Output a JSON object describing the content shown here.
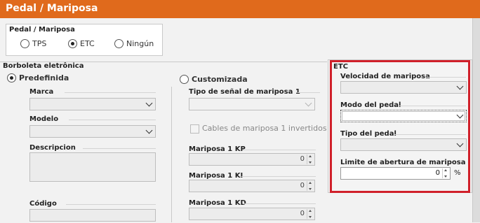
{
  "window": {
    "title": "Pedal / Mariposa"
  },
  "mode_group": {
    "label": "Pedal / Mariposa",
    "options": [
      "TPS",
      "ETC",
      "Ningún"
    ],
    "selected": "ETC"
  },
  "borboleta": {
    "label": "Borboleta eletrônica",
    "predefinida": {
      "label": "Predefinida",
      "marca_label": "Marca",
      "modelo_label": "Modelo",
      "descripcion_label": "Descripcion",
      "codigo_label": "Código"
    },
    "customizada": {
      "label": "Customizada",
      "tipo_label": "Tipo de señal de mariposa 1",
      "cables_label": "Cables de mariposa 1 invertidos",
      "kp_label": "Mariposa 1 KP",
      "kp_value": "0",
      "ki_label": "Mariposa 1 KI",
      "ki_value": "0",
      "kd_label": "Mariposa 1 KD",
      "kd_value": "0"
    }
  },
  "etc": {
    "label": "ETC",
    "velocidad_label": "Velocidad de mariposa",
    "modo_label": "Modo del pedal",
    "tipo_label": "Tipo del pedal",
    "limite_label": "Limite de abertura de mariposa",
    "limite_value": "0",
    "limite_unit": "%"
  },
  "colors": {
    "title_bar": "#e06a1c",
    "highlight_box": "#d0202a"
  }
}
